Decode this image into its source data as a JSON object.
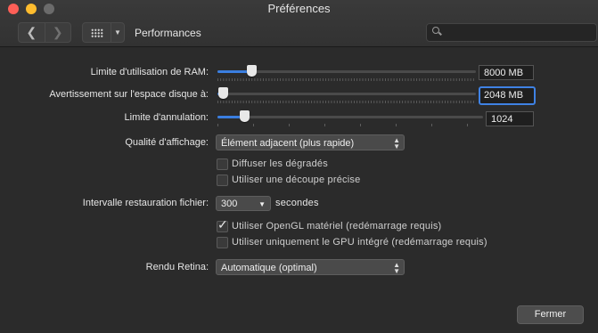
{
  "window": {
    "title": "Préférences"
  },
  "toolbar": {
    "back_glyph": "❮",
    "forward_glyph": "❯",
    "section": "Performances",
    "search_placeholder": ""
  },
  "ram": {
    "label": "Limite d'utilisation de RAM:",
    "value": "8000 MB",
    "level": 0.13
  },
  "disk": {
    "label": "Avertissement sur l'espace disque à:",
    "value": "2048 MB",
    "level": 0.02
  },
  "undo": {
    "label": "Limite d'annulation:",
    "value": "1024",
    "level": 0.1
  },
  "display_quality": {
    "label": "Qualité d'affichage:",
    "value": "Élément adjacent (plus rapide)"
  },
  "options": [
    {
      "label": "Diffuser les dégradés",
      "checked": false
    },
    {
      "label": "Utiliser une découpe précise",
      "checked": false
    }
  ],
  "restore": {
    "label": "Intervalle restauration fichier:",
    "value": "300",
    "unit": "secondes"
  },
  "gpu_options": [
    {
      "label": "Utiliser OpenGL matériel (redémarrage requis)",
      "checked": true
    },
    {
      "label": "Utiliser uniquement le GPU intégré (redémarrage requis)",
      "checked": false
    }
  ],
  "retina": {
    "label": "Rendu Retina:",
    "value": "Automatique (optimal)"
  },
  "close_button": "Fermer"
}
